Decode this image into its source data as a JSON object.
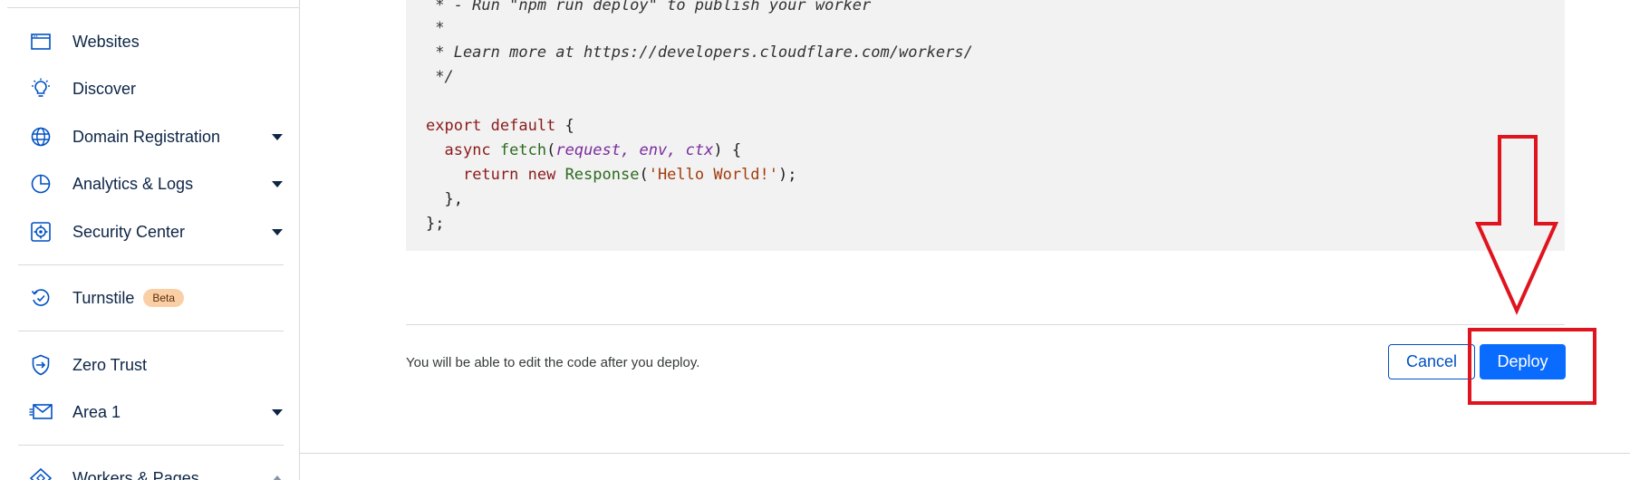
{
  "sidebar": {
    "items": [
      {
        "label": "Websites",
        "icon": "browser-window-icon",
        "has_caret": false
      },
      {
        "label": "Discover",
        "icon": "lightbulb-icon",
        "has_caret": false
      },
      {
        "label": "Domain Registration",
        "icon": "globe-icon",
        "has_caret": true
      },
      {
        "label": "Analytics & Logs",
        "icon": "pie-chart-icon",
        "has_caret": true
      },
      {
        "label": "Security Center",
        "icon": "security-gear-icon",
        "has_caret": true
      },
      {
        "label": "Turnstile",
        "icon": "refresh-check-icon",
        "has_caret": false,
        "badge": "Beta"
      },
      {
        "label": "Zero Trust",
        "icon": "shield-arrow-icon",
        "has_caret": false
      },
      {
        "label": "Area 1",
        "icon": "mail-icon",
        "has_caret": true
      },
      {
        "label": "Workers & Pages",
        "icon": "workers-icon",
        "has_caret": true
      }
    ]
  },
  "code": {
    "lines": [
      " * - Run \"npm run deploy\" to publish your worker",
      " *",
      " * Learn more at https://developers.cloudflare.com/workers/",
      " */",
      "",
      "export default {",
      "  async fetch(request, env, ctx) {",
      "    return new Response('Hello World!');",
      "  },",
      "};"
    ]
  },
  "footer": {
    "hint": "You will be able to edit the code after you deploy.",
    "cancel_label": "Cancel",
    "deploy_label": "Deploy"
  },
  "colors": {
    "accent": "#0a6cff",
    "accent_dark": "#0051c3",
    "annotation": "#e0141e",
    "badge_bg": "#fbcfa5"
  }
}
